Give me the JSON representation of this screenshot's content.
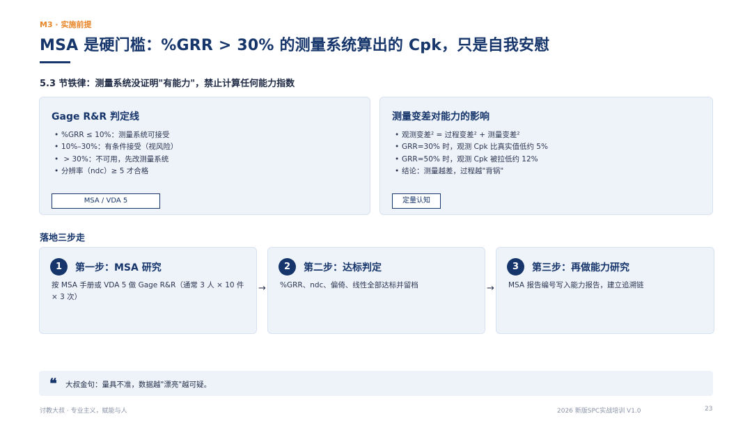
{
  "header": {
    "kicker": "M3 · 实施前提",
    "title": "MSA 是硬门槛：%GRR > 30% 的测量系统算出的 Cpk，只是自我安慰",
    "subtitle": "5.3 节铁律：测量系统没证明\"有能力\"，禁止计算任何能力指数"
  },
  "cards": {
    "left": {
      "title": "Gage R&R 判定线",
      "items": [
        "%GRR ≤ 10%：测量系统可接受",
        "10%–30%：有条件接受（视风险）",
        " > 30%：不可用，先改测量系统",
        "分辨率（ndc）≥ 5 才合格"
      ],
      "tag": "MSA / VDA 5"
    },
    "right": {
      "title": "测量变差对能力的影响",
      "items": [
        "观测变差² = 过程变差² + 测量变差²",
        "GRR=30% 时，观测 Cpk 比真实值低约 5%",
        "GRR=50% 时，观测 Cpk 被拉低约 12%",
        "结论：测量越差，过程越\"背锅\""
      ],
      "tag": "定量认知"
    }
  },
  "steps": {
    "section_label": "落地三步走",
    "items": [
      {
        "number": "1",
        "title": "第一步：MSA 研究",
        "desc": "按 MSA 手册或 VDA 5 做 Gage R&R（通常 3 人 × 10 件 × 3 次）"
      },
      {
        "number": "2",
        "title": "第二步：达标判定",
        "desc": "%GRR、ndc、偏倚、线性全部达标并留档"
      },
      {
        "number": "3",
        "title": "第三步：再做能力研究",
        "desc": "MSA 报告编号写入能力报告，建立追溯链"
      }
    ],
    "arrow": "→"
  },
  "quote": {
    "icon": "quote-icon",
    "mark": "❝",
    "text": "大叔金句：量具不准，数据越\"漂亮\"越可疑。"
  },
  "footer": {
    "left": "讨教大叔 · 专业主义，赋能与人",
    "center": "2026 新版SPC实战培训 V1.0",
    "page": "23"
  },
  "colors": {
    "primary": "#16356b",
    "accent": "#e8862a",
    "card_bg": "#eef3fa"
  }
}
